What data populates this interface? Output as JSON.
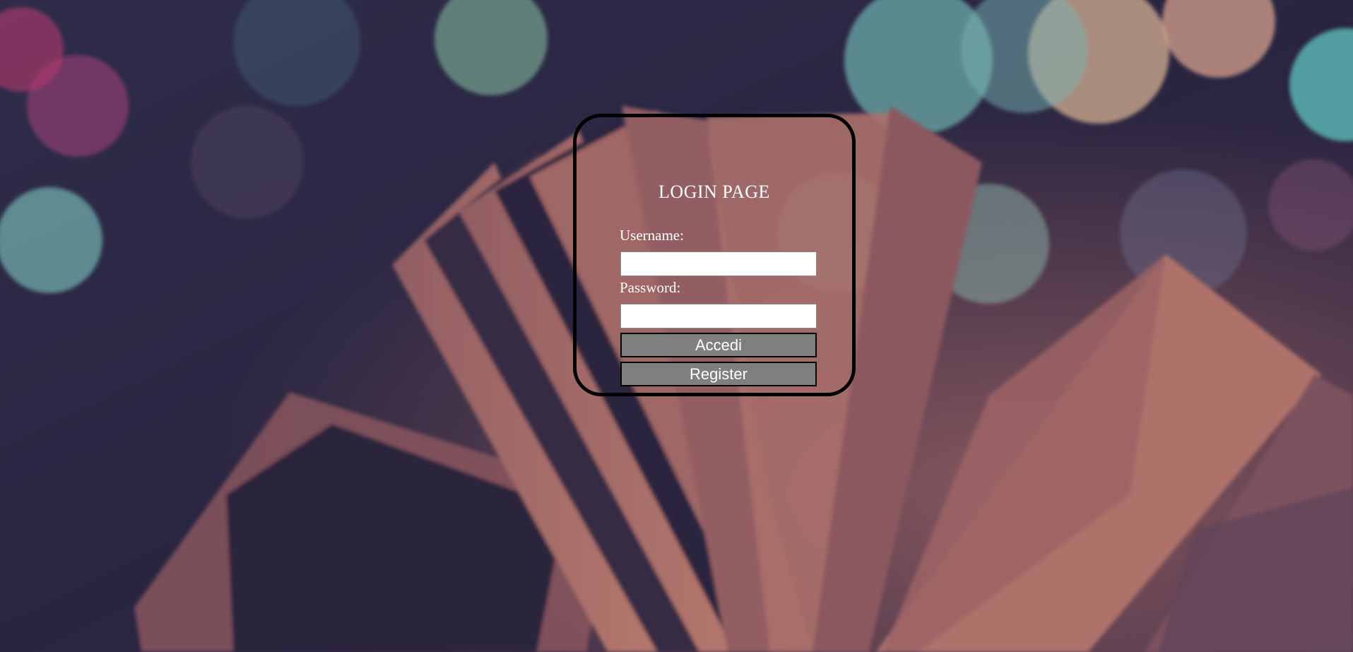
{
  "login": {
    "title": "LOGIN PAGE",
    "username_label": "Username:",
    "username_value": "",
    "password_label": "Password:",
    "password_value": "",
    "login_button": "Accedi",
    "register_button": "Register"
  },
  "background": {
    "subject": "open-book-with-bokeh-lights",
    "colors": {
      "base": "#2a2440",
      "page_pink": "#c98274",
      "bokeh_teal": "#7fd0c8",
      "bokeh_peach": "#f6c9a0",
      "bokeh_magenta": "#d0407a"
    }
  },
  "colors": {
    "box_border": "#000000",
    "text": "#ffffff",
    "button_bg": "#7f7f7f",
    "input_bg": "#ffffff"
  }
}
